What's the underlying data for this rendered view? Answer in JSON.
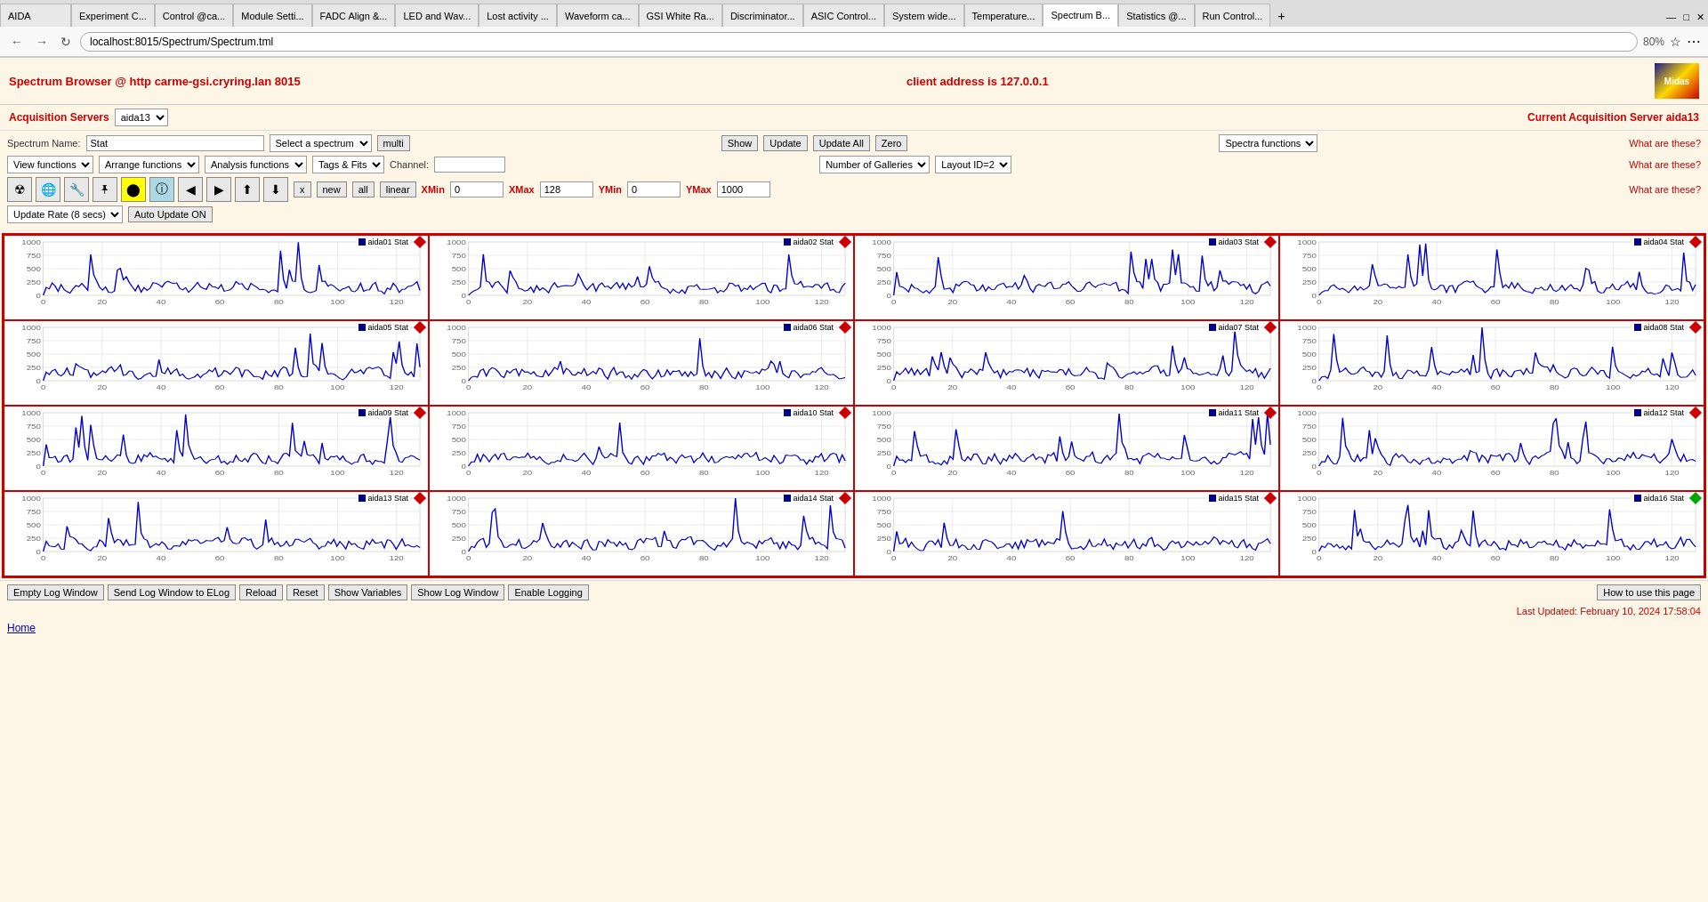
{
  "browser": {
    "tabs": [
      {
        "label": "AIDA",
        "active": false
      },
      {
        "label": "Experiment C...",
        "active": false
      },
      {
        "label": "Control @ca...",
        "active": false
      },
      {
        "label": "Module Setti...",
        "active": false
      },
      {
        "label": "FADC Align &...",
        "active": false
      },
      {
        "label": "LED and Wav...",
        "active": false
      },
      {
        "label": "Lost activity ...",
        "active": false
      },
      {
        "label": "Waveform ca...",
        "active": false
      },
      {
        "label": "GSI White Ra...",
        "active": false
      },
      {
        "label": "Discriminator...",
        "active": false
      },
      {
        "label": "ASIC Control...",
        "active": false
      },
      {
        "label": "System wide ...",
        "active": false
      },
      {
        "label": "Temperature ...",
        "active": false
      },
      {
        "label": "Spectrum B...",
        "active": true
      },
      {
        "label": "Statistics @...",
        "active": false
      },
      {
        "label": "Run Control ...",
        "active": false
      }
    ],
    "address": "localhost:8015/Spectrum/Spectrum.tml",
    "zoom": "80%"
  },
  "header": {
    "title": "Spectrum Browser @ http carme-gsi.cryring.lan 8015",
    "client": "client address is 127.0.0.1"
  },
  "acq": {
    "label": "Acquisition Servers",
    "server_select": "aida13",
    "current_label": "Current Acquisition Server aida13"
  },
  "controls": {
    "spectrum_name_label": "Spectrum Name:",
    "spectrum_name_value": "Stat",
    "select_spectrum": "Select a spectrum",
    "multi_btn": "multi",
    "show_btn": "Show",
    "update_btn": "Update",
    "update_all_btn": "Update All",
    "zero_btn": "Zero",
    "spectra_functions": "Spectra functions",
    "what_are1": "What are these?",
    "view_functions": "View functions",
    "arrange_functions": "Arrange functions",
    "analysis_functions": "Analysis functions",
    "tags_fits": "Tags & Fits",
    "channel_label": "Channel:",
    "channel_value": "",
    "number_of_galleries": "Number of Galleries",
    "layout_id": "Layout ID=2",
    "what_are2": "What are these?",
    "what_are3": "What are these?",
    "x_btn": "x",
    "new_btn": "new",
    "all_btn": "all",
    "linear_btn": "linear",
    "xmin_label": "XMin",
    "xmin_value": "0",
    "xmax_label": "XMax",
    "xmax_value": "128",
    "ymin_label": "YMin",
    "ymin_value": "0",
    "ymax_label": "YMax",
    "ymax_value": "1000",
    "update_rate": "Update Rate (8 secs)",
    "auto_update": "Auto Update ON"
  },
  "spectra": [
    {
      "id": "aida01",
      "name": "aida01 Stat",
      "status": "red"
    },
    {
      "id": "aida02",
      "name": "aida02 Stat",
      "status": "red"
    },
    {
      "id": "aida03",
      "name": "aida03 Stat",
      "status": "red"
    },
    {
      "id": "aida04",
      "name": "aida04 Stat",
      "status": "red"
    },
    {
      "id": "aida05",
      "name": "aida05 Stat",
      "status": "red"
    },
    {
      "id": "aida06",
      "name": "aida06 Stat",
      "status": "red"
    },
    {
      "id": "aida07",
      "name": "aida07 Stat",
      "status": "red"
    },
    {
      "id": "aida08",
      "name": "aida08 Stat",
      "status": "red"
    },
    {
      "id": "aida09",
      "name": "aida09 Stat",
      "status": "red"
    },
    {
      "id": "aida10",
      "name": "aida10 Stat",
      "status": "red"
    },
    {
      "id": "aida11",
      "name": "aida11 Stat",
      "status": "red"
    },
    {
      "id": "aida12",
      "name": "aida12 Stat",
      "status": "red"
    },
    {
      "id": "aida13",
      "name": "aida13 Stat",
      "status": "red"
    },
    {
      "id": "aida14",
      "name": "aida14 Stat",
      "status": "red"
    },
    {
      "id": "aida15",
      "name": "aida15 Stat",
      "status": "red"
    },
    {
      "id": "aida16",
      "name": "aida16 Stat",
      "status": "green"
    }
  ],
  "footer": {
    "empty_log": "Empty Log Window",
    "send_log": "Send Log Window to ELog",
    "reload": "Reload",
    "reset": "Reset",
    "show_variables": "Show Variables",
    "show_log": "Show Log Window",
    "enable_logging": "Enable Logging",
    "how_to": "How to use this page",
    "last_updated": "Last Updated: February 10, 2024 17:58:04",
    "home": "Home"
  }
}
